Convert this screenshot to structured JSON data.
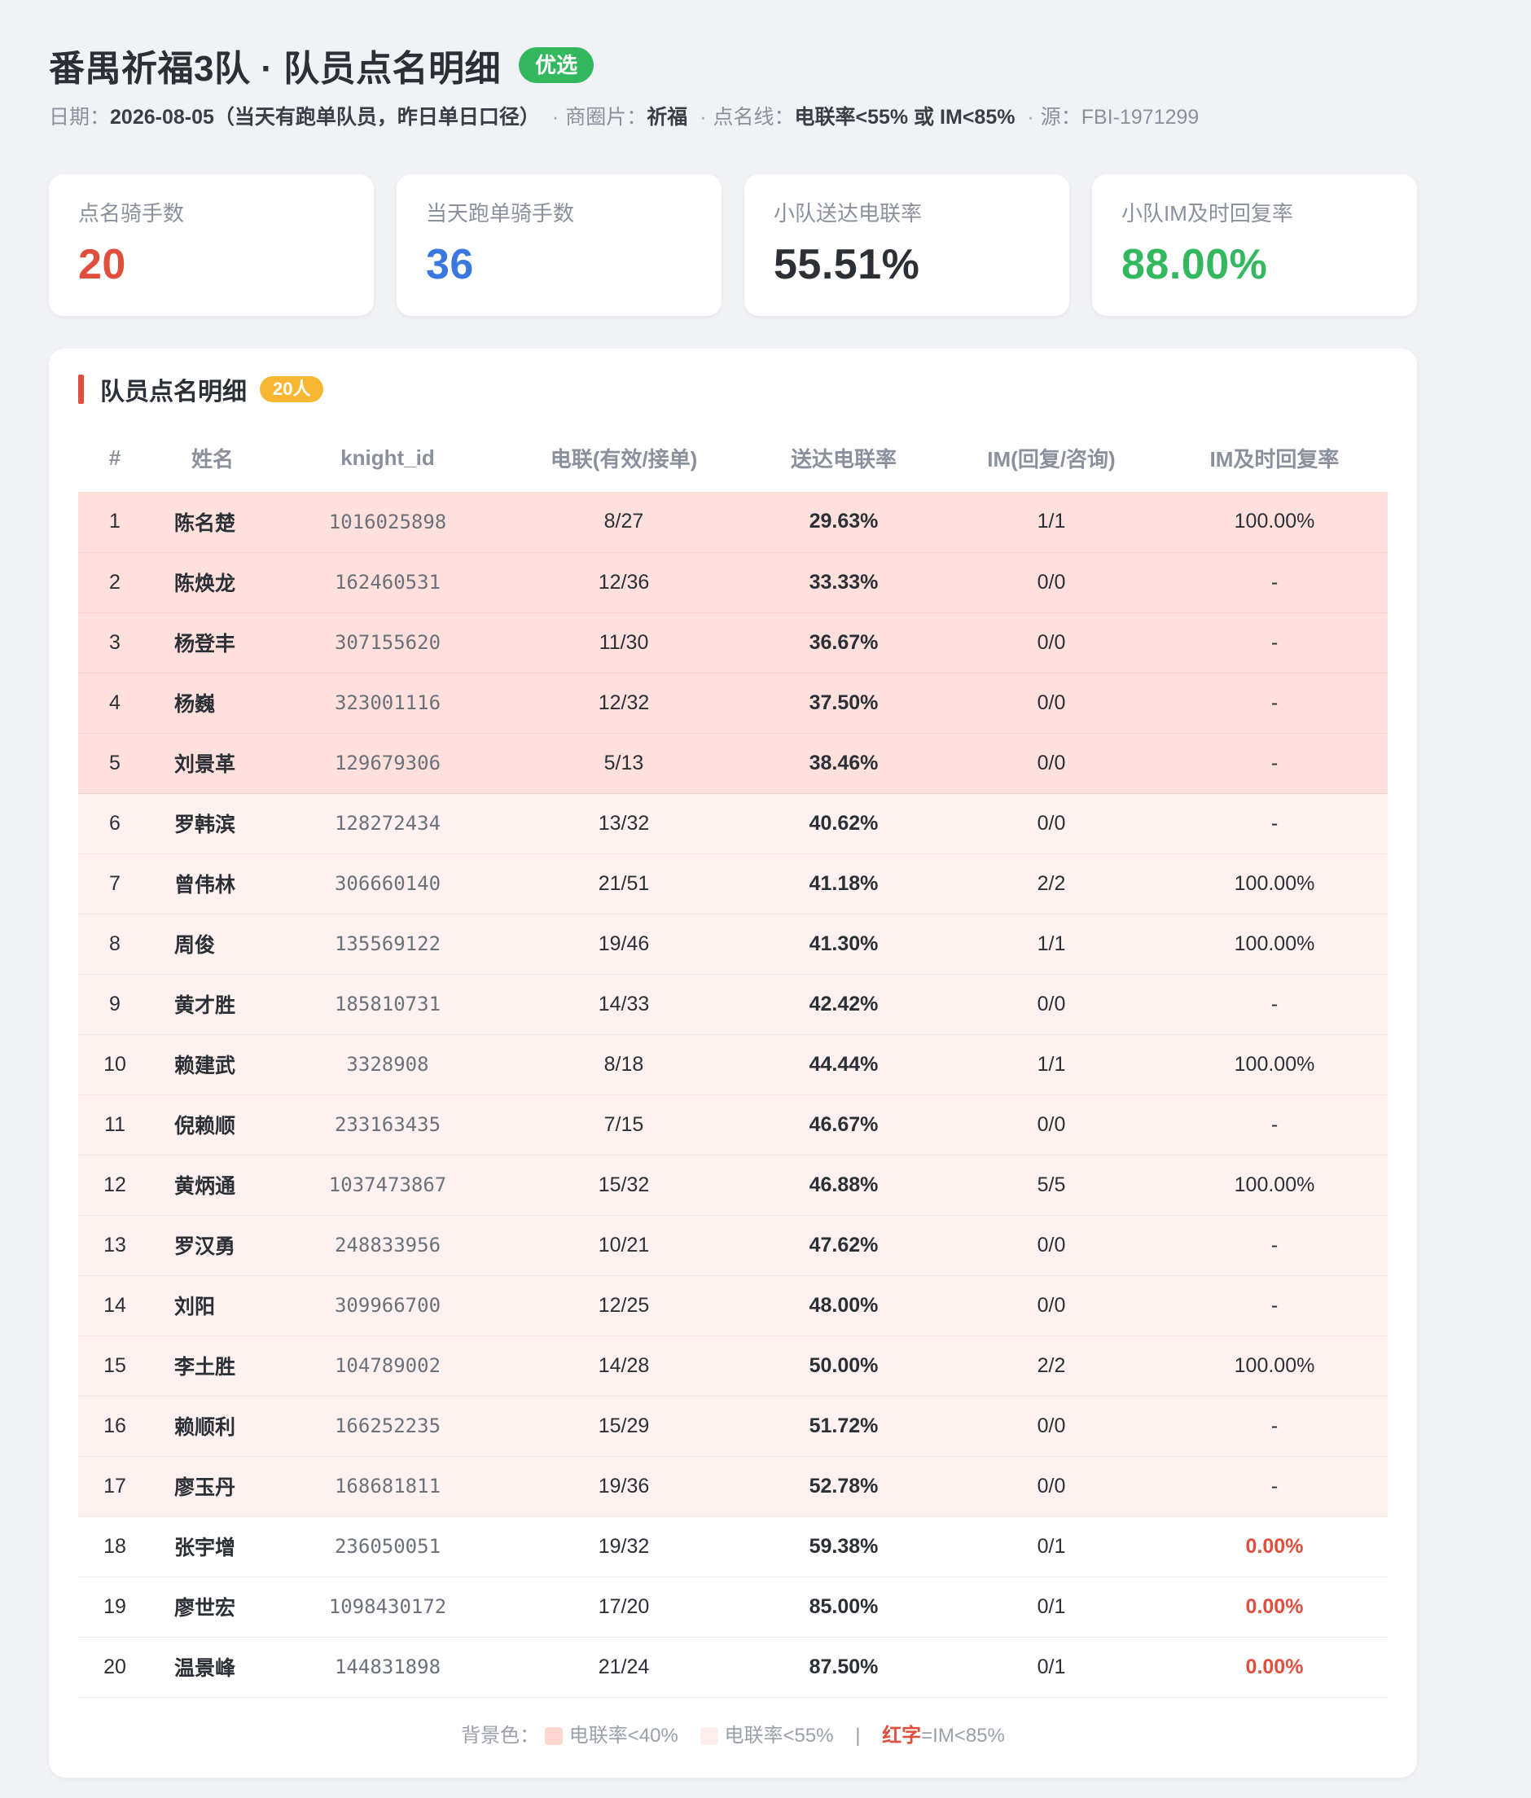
{
  "header": {
    "title": "番禺祈福3队 · 队员点名明细",
    "badge": "优选",
    "date_label": "日期：",
    "date_value": "2026-08-05（当天有跑单队员，昨日单日口径）",
    "area_label": "商圈片：",
    "area_value": "祈福",
    "line_label": "点名线：",
    "line_value": "电联率<55% 或 IM<85%",
    "source_label": "源：",
    "source_value": "FBI-1971299",
    "sep": "·"
  },
  "cards": [
    {
      "label": "点名骑手数",
      "value": "20",
      "color": "#e04f3e"
    },
    {
      "label": "当天跑单骑手数",
      "value": "36",
      "color": "#3a78e0"
    },
    {
      "label": "小队送达电联率",
      "value": "55.51%",
      "color": "#2b2f36"
    },
    {
      "label": "小队IM及时回复率",
      "value": "88.00%",
      "color": "#34b85f"
    }
  ],
  "panel": {
    "title": "队员点名明细",
    "count_badge": "20人"
  },
  "table": {
    "columns": [
      "#",
      "姓名",
      "knight_id",
      "电联(有效/接单)",
      "送达电联率",
      "IM(回复/咨询)",
      "IM及时回复率"
    ],
    "rows": [
      {
        "no": "1",
        "name": "陈名楚",
        "kid": "1016025898",
        "calls": "8/27",
        "rate": "29.63%",
        "im": "1/1",
        "im_rate": "100.00%",
        "level": "sev",
        "im_red": false
      },
      {
        "no": "2",
        "name": "陈焕龙",
        "kid": "162460531",
        "calls": "12/36",
        "rate": "33.33%",
        "im": "0/0",
        "im_rate": "-",
        "level": "sev",
        "im_red": false
      },
      {
        "no": "3",
        "name": "杨登丰",
        "kid": "307155620",
        "calls": "11/30",
        "rate": "36.67%",
        "im": "0/0",
        "im_rate": "-",
        "level": "sev",
        "im_red": false
      },
      {
        "no": "4",
        "name": "杨巍",
        "kid": "323001116",
        "calls": "12/32",
        "rate": "37.50%",
        "im": "0/0",
        "im_rate": "-",
        "level": "sev",
        "im_red": false
      },
      {
        "no": "5",
        "name": "刘景革",
        "kid": "129679306",
        "calls": "5/13",
        "rate": "38.46%",
        "im": "0/0",
        "im_rate": "-",
        "level": "sev",
        "im_red": false
      },
      {
        "no": "6",
        "name": "罗韩滨",
        "kid": "128272434",
        "calls": "13/32",
        "rate": "40.62%",
        "im": "0/0",
        "im_rate": "-",
        "level": "mild",
        "im_red": false
      },
      {
        "no": "7",
        "name": "曾伟林",
        "kid": "306660140",
        "calls": "21/51",
        "rate": "41.18%",
        "im": "2/2",
        "im_rate": "100.00%",
        "level": "mild",
        "im_red": false
      },
      {
        "no": "8",
        "name": "周俊",
        "kid": "135569122",
        "calls": "19/46",
        "rate": "41.30%",
        "im": "1/1",
        "im_rate": "100.00%",
        "level": "mild",
        "im_red": false
      },
      {
        "no": "9",
        "name": "黄才胜",
        "kid": "185810731",
        "calls": "14/33",
        "rate": "42.42%",
        "im": "0/0",
        "im_rate": "-",
        "level": "mild",
        "im_red": false
      },
      {
        "no": "10",
        "name": "赖建武",
        "kid": "3328908",
        "calls": "8/18",
        "rate": "44.44%",
        "im": "1/1",
        "im_rate": "100.00%",
        "level": "mild",
        "im_red": false
      },
      {
        "no": "11",
        "name": "倪赖顺",
        "kid": "233163435",
        "calls": "7/15",
        "rate": "46.67%",
        "im": "0/0",
        "im_rate": "-",
        "level": "mild",
        "im_red": false
      },
      {
        "no": "12",
        "name": "黄炳通",
        "kid": "1037473867",
        "calls": "15/32",
        "rate": "46.88%",
        "im": "5/5",
        "im_rate": "100.00%",
        "level": "mild",
        "im_red": false
      },
      {
        "no": "13",
        "name": "罗汉勇",
        "kid": "248833956",
        "calls": "10/21",
        "rate": "47.62%",
        "im": "0/0",
        "im_rate": "-",
        "level": "mild",
        "im_red": false
      },
      {
        "no": "14",
        "name": "刘阳",
        "kid": "309966700",
        "calls": "12/25",
        "rate": "48.00%",
        "im": "0/0",
        "im_rate": "-",
        "level": "mild",
        "im_red": false
      },
      {
        "no": "15",
        "name": "李土胜",
        "kid": "104789002",
        "calls": "14/28",
        "rate": "50.00%",
        "im": "2/2",
        "im_rate": "100.00%",
        "level": "mild",
        "im_red": false
      },
      {
        "no": "16",
        "name": "赖顺利",
        "kid": "166252235",
        "calls": "15/29",
        "rate": "51.72%",
        "im": "0/0",
        "im_rate": "-",
        "level": "mild",
        "im_red": false
      },
      {
        "no": "17",
        "name": "廖玉丹",
        "kid": "168681811",
        "calls": "19/36",
        "rate": "52.78%",
        "im": "0/0",
        "im_rate": "-",
        "level": "mild",
        "im_red": false
      },
      {
        "no": "18",
        "name": "张宇增",
        "kid": "236050051",
        "calls": "19/32",
        "rate": "59.38%",
        "im": "0/1",
        "im_rate": "0.00%",
        "level": "none",
        "im_red": true
      },
      {
        "no": "19",
        "name": "廖世宏",
        "kid": "1098430172",
        "calls": "17/20",
        "rate": "85.00%",
        "im": "0/1",
        "im_rate": "0.00%",
        "level": "none",
        "im_red": true
      },
      {
        "no": "20",
        "name": "温景峰",
        "kid": "144831898",
        "calls": "21/24",
        "rate": "87.50%",
        "im": "0/1",
        "im_rate": "0.00%",
        "level": "none",
        "im_red": true
      }
    ]
  },
  "legend": {
    "prefix": "背景色：",
    "sev_label": "电联率<40%",
    "mild_label": "电联率<55%",
    "divider": "|",
    "red_word": "红字",
    "red_rule": "=IM<85%",
    "sev_color": "#ffd6d0",
    "mild_color": "#ffeeeb"
  }
}
